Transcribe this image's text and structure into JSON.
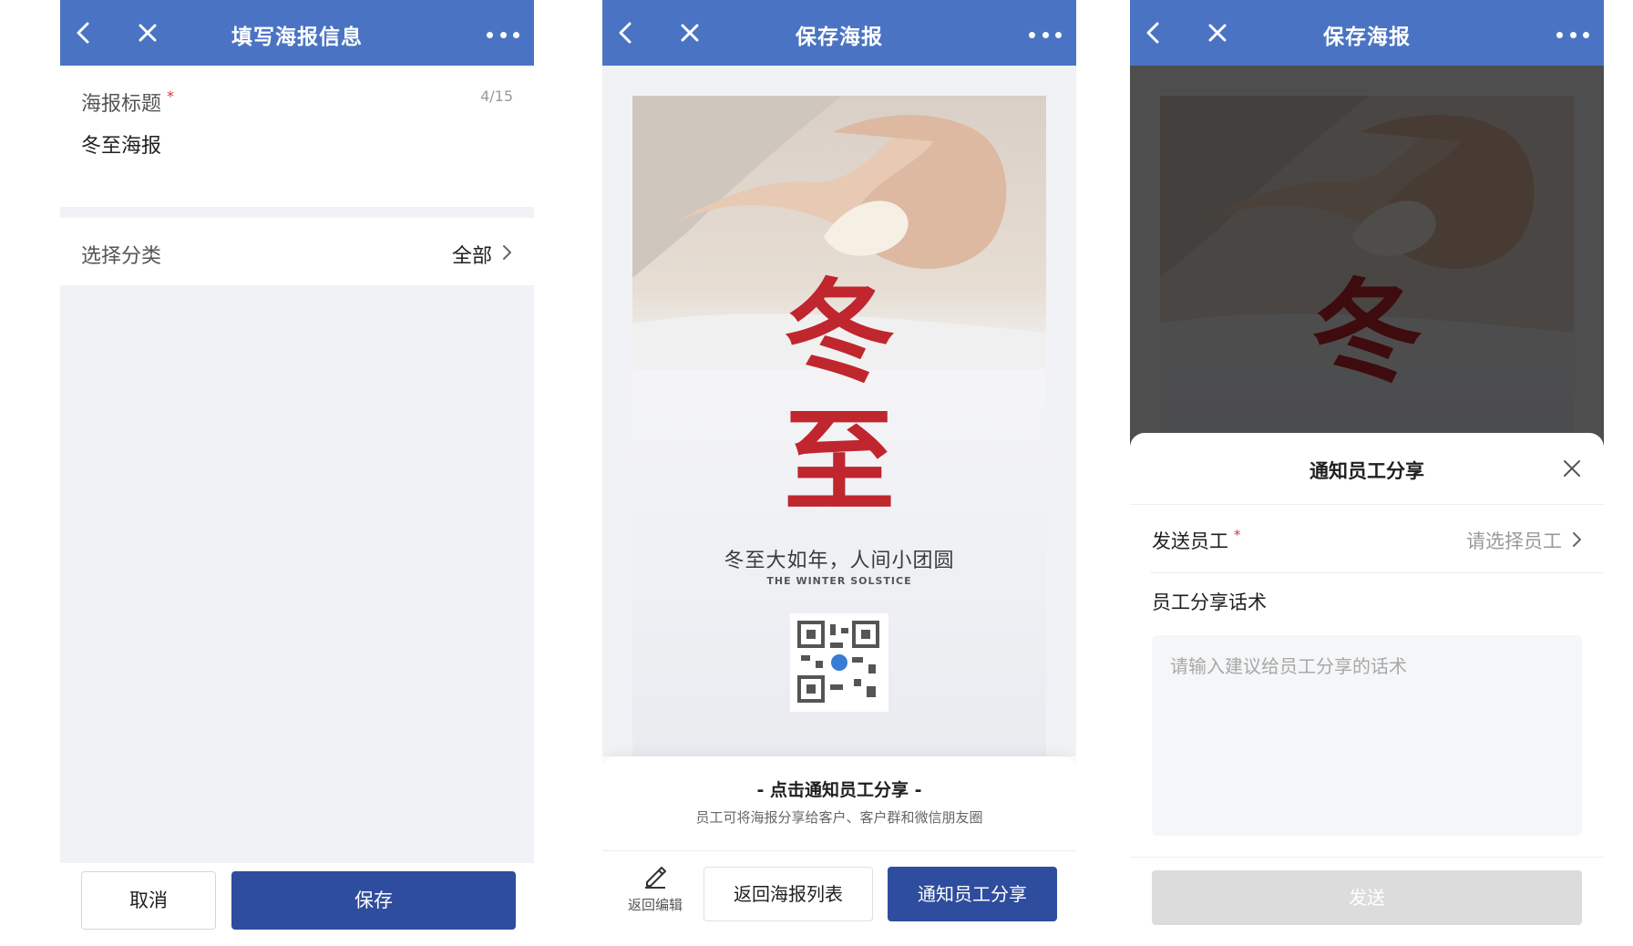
{
  "colors": {
    "nav_bg": "#4a74c3",
    "primary": "#2f4d9e",
    "required": "#d9363e",
    "poster_red": "#c0262d"
  },
  "icons": {
    "back": "chevron-left-icon",
    "close": "close-icon",
    "more": "more-dots-icon",
    "chevron": "chevron-right-icon",
    "edit": "pencil-icon"
  },
  "screen1": {
    "nav_title": "填写海报信息",
    "title_label": "海报标题",
    "required_mark": "*",
    "title_count": "4/15",
    "title_value": "冬至海报",
    "category_label": "选择分类",
    "category_value": "全部",
    "cancel_label": "取消",
    "save_label": "保存"
  },
  "poster": {
    "char1": "冬",
    "char2": "至",
    "tagline": "冬至大如年，人间小团圆",
    "english": "THE WINTER SOLSTICE"
  },
  "screen2": {
    "nav_title": "保存海报",
    "sheet_title": "- 点击通知员工分享 -",
    "sheet_desc": "员工可将海报分享给客户、客户群和微信朋友圈",
    "edit_label": "返回编辑",
    "return_label": "返回海报列表",
    "notify_label": "通知员工分享"
  },
  "screen3": {
    "nav_title": "保存海报",
    "sheet_title": "通知员工分享",
    "send_label": "发送员工",
    "required_mark": "*",
    "send_placeholder": "请选择员工",
    "script_label": "员工分享话术",
    "script_placeholder": "请输入建议给员工分享的话术",
    "send_button": "发送"
  }
}
